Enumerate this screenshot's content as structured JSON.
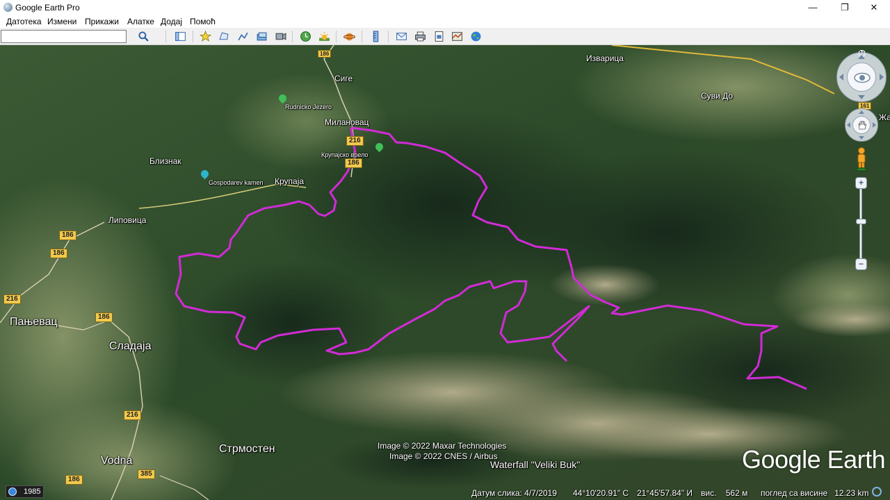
{
  "window": {
    "title": "Google Earth Pro",
    "minimize": "—",
    "maximize": "❐",
    "close": "✕"
  },
  "menu": [
    "Датотека",
    "Измени",
    "Прикажи",
    "Алатке",
    "Додај",
    "Помоћ"
  ],
  "search": {
    "value": "",
    "placeholder": ""
  },
  "toolbar_icons": [
    "search-icon",
    "sidebar-icon",
    "placemark-icon",
    "polygon-icon",
    "path-icon",
    "overlay-icon",
    "tour-icon",
    "historical-imagery-icon",
    "sunlight-icon",
    "planets-icon",
    "ruler-icon",
    "email-icon",
    "print-icon",
    "save-image-icon",
    "maps-icon",
    "globe-icon"
  ],
  "map": {
    "places": {
      "izvarica": "Изварица",
      "suvi_do": "Суви До",
      "zh": "Жа",
      "sige": "Сиге",
      "rudnicko_jezero": "Rudnicko Jezero",
      "milanovac": "Милановац",
      "krupajsko_vrelo": "Крупајско врело",
      "bliznak": "Близнак",
      "gospodarev_kamen": "Gospodarev kamen",
      "krupaja": "Крупаја",
      "lipovica": "Липовица",
      "panjevac": "Пањевац",
      "sladaja": "Сладаја",
      "vodna": "Vodna",
      "strmosten": "Стрмостен",
      "waterfall": "Waterfall \"Veliki Buk\""
    },
    "roads": {
      "r186_top": "186",
      "r216_a": "216",
      "r186_b": "186",
      "r186_left1": "186",
      "r186_left2": "186",
      "r216_left": "216",
      "r186_mid": "186",
      "r216_lower": "216",
      "r186_bottom": "186",
      "r385": "385",
      "r161": "161"
    },
    "attribution": [
      "Image © 2022 Maxar Technologies",
      "Image © 2022 CNES / Airbus"
    ],
    "brand": "Google Earth",
    "track_color": "#d12bd6",
    "compass_label": "N"
  },
  "status": {
    "year": "1985",
    "date": "Датум слика: 4/7/2019",
    "lat": "44°10'20.91\" С",
    "lon": "21°45'57.84\" И",
    "elev": "вис.    562 м",
    "eye": "поглед са висине   12.23 km"
  }
}
